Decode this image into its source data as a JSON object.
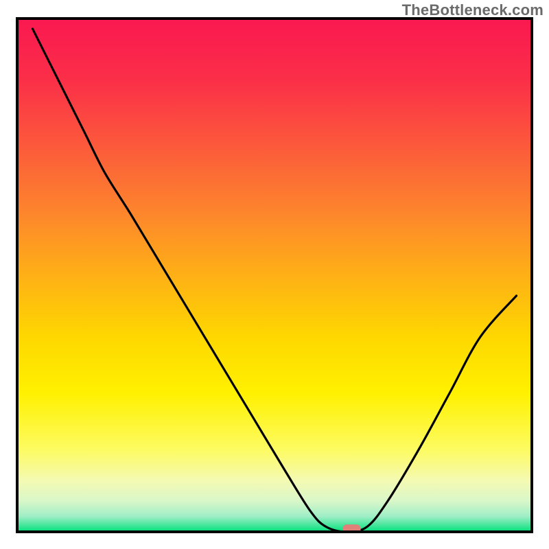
{
  "watermark": "TheBottleneck.com",
  "chart_data": {
    "type": "line",
    "title": "",
    "xlabel": "",
    "ylabel": "",
    "xlim": [
      0,
      100
    ],
    "ylim": [
      0,
      100
    ],
    "grid": false,
    "legend": false,
    "annotations": [],
    "background_gradient_colors_top_to_bottom": [
      "#fa1850",
      "#fc4440",
      "#fd7c2e",
      "#fead18",
      "#fed700",
      "#fff200",
      "#fdfd72",
      "#f1fac0",
      "#c7f5d3",
      "#00e07a"
    ],
    "curve_points": [
      {
        "x": 3,
        "y": 98
      },
      {
        "x": 8,
        "y": 88
      },
      {
        "x": 13,
        "y": 78
      },
      {
        "x": 17,
        "y": 70
      },
      {
        "x": 22,
        "y": 62
      },
      {
        "x": 28,
        "y": 52
      },
      {
        "x": 34,
        "y": 42
      },
      {
        "x": 40,
        "y": 32
      },
      {
        "x": 46,
        "y": 22
      },
      {
        "x": 52,
        "y": 12
      },
      {
        "x": 57,
        "y": 4
      },
      {
        "x": 60,
        "y": 1
      },
      {
        "x": 64,
        "y": 0
      },
      {
        "x": 68,
        "y": 1
      },
      {
        "x": 72,
        "y": 6
      },
      {
        "x": 78,
        "y": 16
      },
      {
        "x": 84,
        "y": 27
      },
      {
        "x": 90,
        "y": 38
      },
      {
        "x": 97,
        "y": 46
      }
    ],
    "marker": {
      "x": 65,
      "y": 0.5,
      "color": "#e08079",
      "shape": "rounded-rect"
    }
  }
}
